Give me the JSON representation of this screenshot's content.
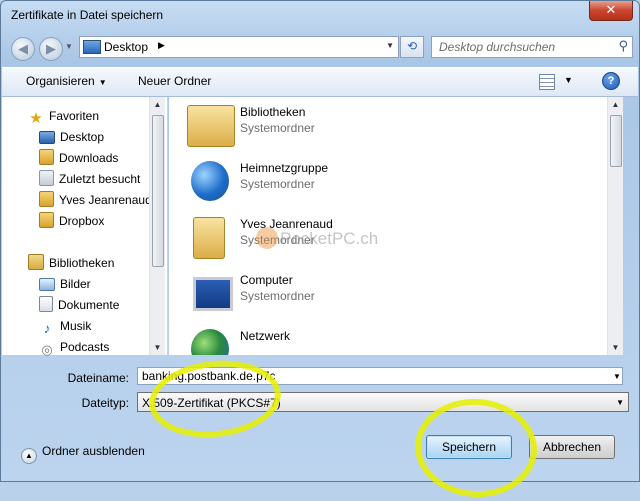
{
  "window": {
    "title": "Zertifikate in Datei speichern",
    "close_label": "✕"
  },
  "address": {
    "location": "Desktop",
    "search_placeholder": "Desktop durchsuchen"
  },
  "toolbar": {
    "organize_label": "Organisieren",
    "new_folder_label": "Neuer Ordner"
  },
  "sidebar": {
    "favorites": [
      {
        "label": "Favoriten",
        "icon": "star-icon"
      },
      {
        "label": "Desktop",
        "icon": "desktop-icon"
      },
      {
        "label": "Downloads",
        "icon": "downloads-icon"
      },
      {
        "label": "Zuletzt besucht",
        "icon": "recent-icon"
      },
      {
        "label": "Yves Jeanrenaud",
        "icon": "user-folder-icon"
      },
      {
        "label": "Dropbox",
        "icon": "dropbox-icon"
      }
    ],
    "libraries": [
      {
        "label": "Bibliotheken",
        "icon": "library-icon"
      },
      {
        "label": "Bilder",
        "icon": "pictures-icon"
      },
      {
        "label": "Dokumente",
        "icon": "documents-icon"
      },
      {
        "label": "Musik",
        "icon": "music-icon"
      },
      {
        "label": "Podcasts",
        "icon": "podcast-icon"
      }
    ]
  },
  "files": [
    {
      "name": "Bibliotheken",
      "type": "Systemordner",
      "icon": "libraries-folder-icon"
    },
    {
      "name": "Heimnetzgruppe",
      "type": "Systemordner",
      "icon": "homegroup-icon"
    },
    {
      "name": "Yves Jeanrenaud",
      "type": "Systemordner",
      "icon": "user-folder-icon"
    },
    {
      "name": "Computer",
      "type": "Systemordner",
      "icon": "computer-icon"
    },
    {
      "name": "Netzwerk",
      "type": "",
      "icon": "network-icon"
    }
  ],
  "watermark": "PocketPC.ch",
  "form": {
    "filename_label": "Dateiname:",
    "filename_value": "banking.postbank.de.p7c",
    "filetype_label": "Dateityp:",
    "filetype_value": "X.509-Zertifikat (PKCS#7)"
  },
  "footer": {
    "hide_folders_label": "Ordner ausblenden",
    "save_label": "Speichern",
    "cancel_label": "Abbrechen"
  },
  "colors": {
    "highlight": "#e6f000",
    "accent": "#3c7fb1"
  }
}
